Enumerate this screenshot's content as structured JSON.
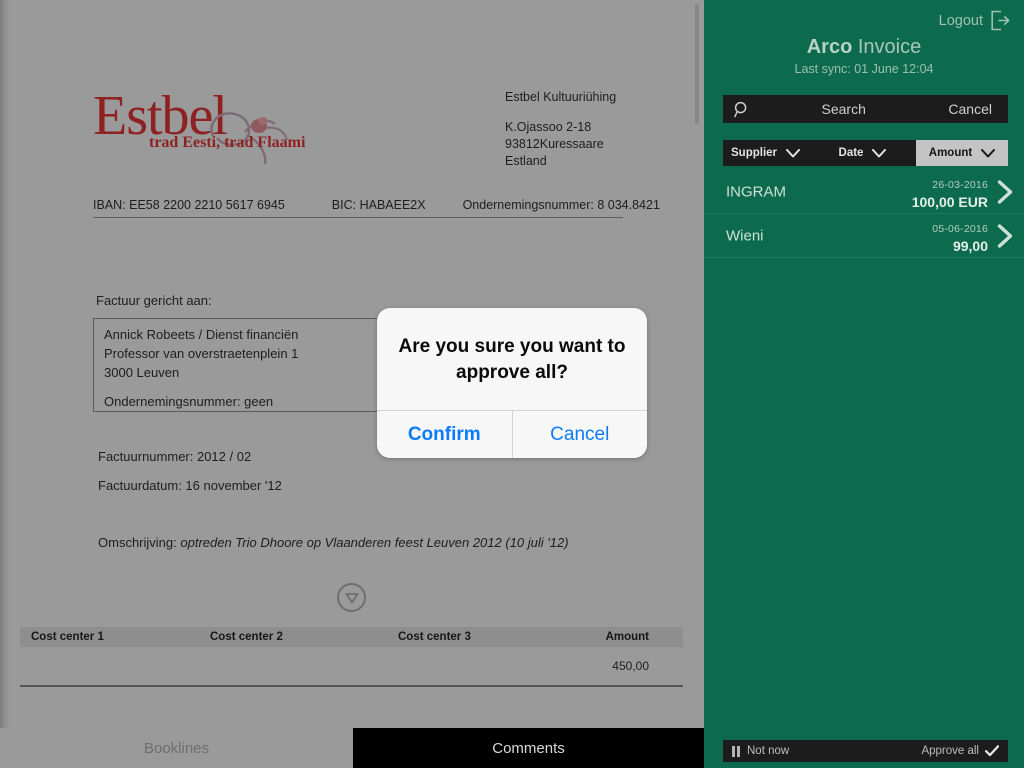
{
  "document": {
    "logo": {
      "word": "Estbel",
      "tagline": "trad Eesti, trad Flaami",
      "color": "#8e2121"
    },
    "company": {
      "name": "Estbel Kultuuriühing",
      "address_lines": [
        "K.Ojassoo 2-18",
        "93812Kuressaare",
        "Estland"
      ]
    },
    "bank": {
      "iban": "IBAN: EE58 2200 2210 5617 6945",
      "bic": "BIC: HABAEE2X",
      "company_number": "Ondernemingsnummer: 8 034.8421"
    },
    "addressed_to_label": "Factuur gericht aan:",
    "addressed_to": {
      "line1": "Annick Robeets / Dienst financiën",
      "line2": "Professor van overstraetenplein 1",
      "line3": "3000 Leuven",
      "line4": "Ondernemingsnummer: geen"
    },
    "invoice_number": "Factuurnummer: 2012 / 02",
    "invoice_date": "Factuurdatum: 16 november '12",
    "description_label": "Omschrijving:",
    "description_value": "optreden Trio Dhoore op Vlaanderen feest Leuven 2012 (10 juli '12)",
    "cost_table": {
      "headers": [
        "Cost center 1",
        "Cost center 2",
        "Cost center 3",
        "Amount"
      ],
      "rows": [
        [
          "",
          "",
          "",
          "450,00"
        ]
      ]
    },
    "tabs": [
      {
        "label": "Booklines",
        "active": false
      },
      {
        "label": "Comments",
        "active": true
      }
    ]
  },
  "sidebar": {
    "logout_label": "Logout",
    "title_brand": "Arco",
    "title_rest": "Invoice",
    "last_sync": "Last sync: 01 June 12:04",
    "search": {
      "placeholder": "Search",
      "value": "",
      "cancel_label": "Cancel"
    },
    "filters": [
      {
        "label": "Supplier",
        "active": false
      },
      {
        "label": "Date",
        "active": false
      },
      {
        "label": "Amount",
        "active": true
      }
    ],
    "invoices": [
      {
        "supplier": "INGRAM",
        "date": "26-03-2016",
        "amount": "100,00 EUR"
      },
      {
        "supplier": "Wieni",
        "date": "05-06-2016",
        "amount": "99,00"
      }
    ],
    "actions": {
      "not_now_label": "Not now",
      "approve_all_label": "Approve all"
    },
    "accent_green": "#0d6b4d"
  },
  "dialog": {
    "title": "Are you sure you want to approve all?",
    "confirm_label": "Confirm",
    "cancel_label": "Cancel",
    "link_color": "#0a7cfb"
  }
}
